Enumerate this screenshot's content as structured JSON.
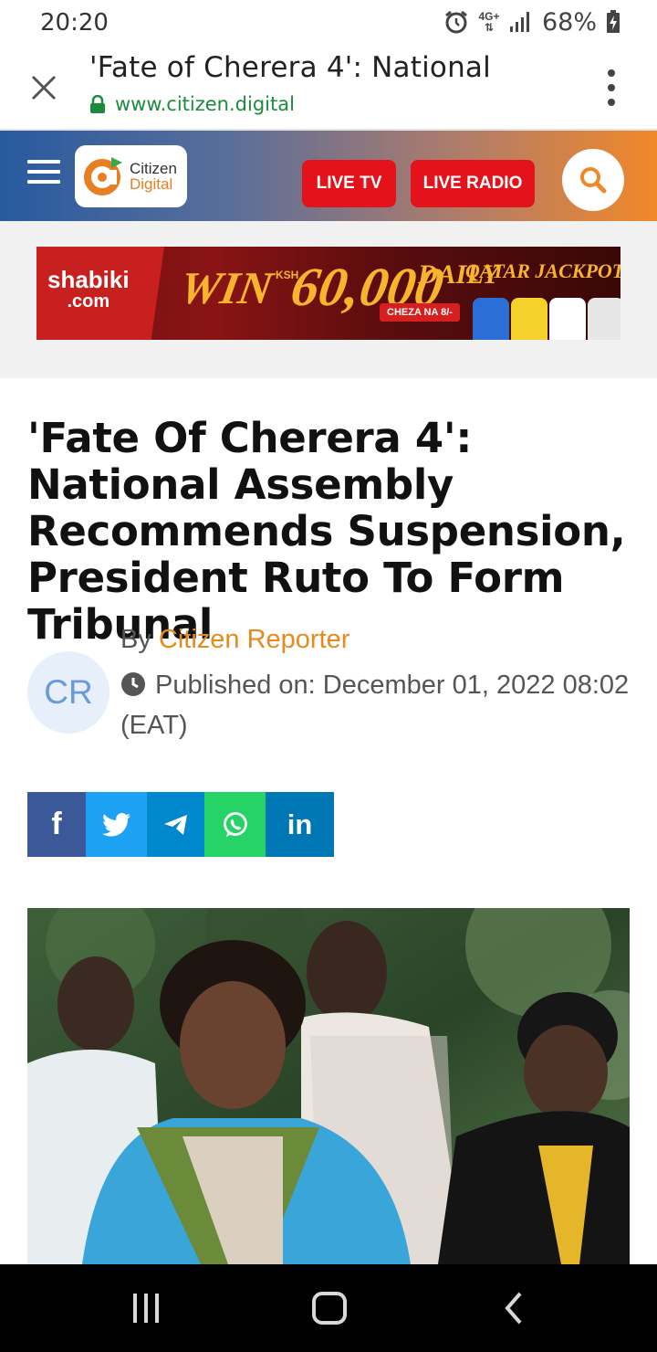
{
  "status_bar": {
    "time": "20:20",
    "network": "4G+",
    "battery": "68%"
  },
  "browser": {
    "page_title": "'Fate of Cherera 4': National",
    "url": "www.citizen.digital"
  },
  "header": {
    "logo_line1": "Citizen",
    "logo_line2": "Digital",
    "live_tv": "LIVE TV",
    "live_radio": "LIVE RADIO"
  },
  "ad": {
    "brand": "shabiki",
    "brand_suffix": ".com",
    "win": "WIN",
    "currency": "KSH",
    "amount": "60,000",
    "daily": "DAILY",
    "jackpot": "QATAR JACKPOT",
    "cta": "CHEZA NA 8/-"
  },
  "article": {
    "headline": "'Fate Of Cherera 4': National Assembly Recommends Suspension, President Ruto To Form Tribunal",
    "avatar_initials": "CR",
    "by": "By",
    "author": "Citizen Reporter",
    "published": "Published on: December 01, 2022 08:02 (EAT)"
  },
  "share": {
    "icons": [
      "facebook-icon",
      "twitter-icon",
      "telegram-icon",
      "whatsapp-icon",
      "linkedin-icon"
    ],
    "linkedin_text": "in",
    "facebook_text": "f"
  },
  "colors": {
    "live_red": "#e3121b",
    "author_orange": "#e58a1f",
    "url_green": "#1b8b3c",
    "header_blue": "#275a9f",
    "header_orange": "#f0882a"
  }
}
